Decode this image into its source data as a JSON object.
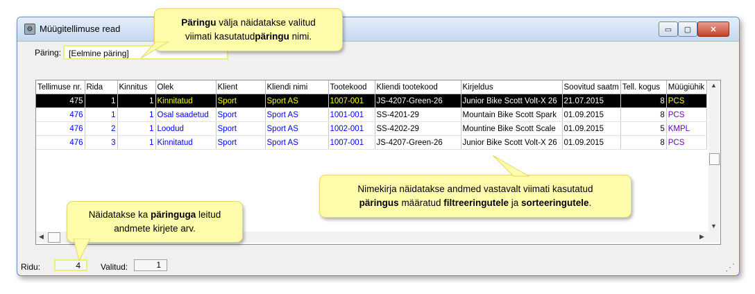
{
  "window": {
    "title": "Müügitellimuse read",
    "icon": "gear-icon",
    "buttons": {
      "minimize": "▭",
      "maximize": "▢",
      "close": "✕"
    }
  },
  "query": {
    "label": "Päring:",
    "value": "[Eelmine päring]"
  },
  "grid": {
    "columns": [
      "Tellimuse nr.",
      "Rida",
      "Kinnitus",
      "Olek",
      "Klient",
      "Kliendi nimi",
      "Tootekood",
      "Kliendi tootekood",
      "Kirjeldus",
      "Soovitud saatm",
      "Tell. kogus",
      "Müügiühik"
    ],
    "rows": [
      [
        "475",
        "1",
        "1",
        "Kinnitatud",
        "Sport",
        "Sport AS",
        "1007-001",
        "JS-4207-Green-26",
        "Junior Bike Scott Volt-X 26",
        "21.07.2015",
        "8",
        "PCS"
      ],
      [
        "476",
        "1",
        "1",
        "Osal saadetud",
        "Sport",
        "Sport AS",
        "1001-001",
        "SS-4201-29",
        "Mountain Bike Scott Spark",
        "01.09.2015",
        "8",
        "PCS"
      ],
      [
        "476",
        "2",
        "1",
        "Loodud",
        "Sport",
        "Sport AS",
        "1002-001",
        "SS-4202-29",
        "Mountine Bike Scott Scale",
        "01.09.2015",
        "5",
        "KMPL"
      ],
      [
        "476",
        "3",
        "1",
        "Kinnitatud",
        "Sport",
        "Sport AS",
        "1007-001",
        "JS-4207-Green-26",
        "Junior Bike Scott Volt-X 26",
        "01.09.2015",
        "8",
        "PCS"
      ]
    ],
    "selected_row": 0
  },
  "status": {
    "rows_label": "Ridu:",
    "rows_value": "4",
    "selected_label": "Valitud:",
    "selected_value": "1"
  },
  "callouts": {
    "query": {
      "bold1": "Päringu",
      "text1": " välja näidatakse valitud",
      "text2": "viimati kasutatud",
      "bold2": "päringu",
      "text3": " nimi."
    },
    "list": {
      "text1": "Nimekirja näidatakse andmed vastavalt viimati kasutatud",
      "bold1": "päringus",
      "text2": " määratud ",
      "bold2": "filtreeringutele",
      "text3": " ja ",
      "bold3": "sorteeringutele",
      "text4": "."
    },
    "count": {
      "text1": "Näidatakse ka ",
      "bold1": "päringuga",
      "text2": " leitud",
      "text3": "andmete kirjete arv."
    }
  },
  "colors": {
    "callout_bg": "#fffdab",
    "highlight": "#e8f07a",
    "selected_row_bg": "#000000",
    "selected_row_text": "#ffff00",
    "row_text": "#0000ff"
  }
}
